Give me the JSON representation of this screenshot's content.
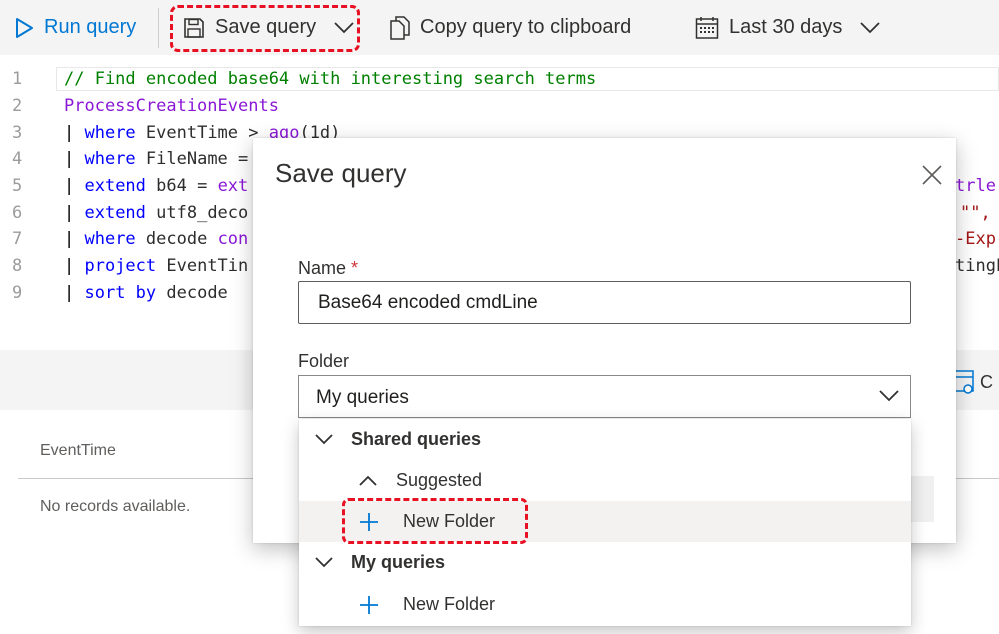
{
  "toolbar": {
    "run_label": "Run query",
    "save_label": "Save query",
    "copy_label": "Copy query to clipboard",
    "range_label": "Last 30 days"
  },
  "editor": {
    "line_numbers": [
      "1",
      "2",
      "3",
      "4",
      "5",
      "6",
      "7",
      "8",
      "9"
    ],
    "lines": [
      {
        "parts": [
          {
            "t": "// Find encoded base64 with interesting search terms",
            "c": "cmt"
          }
        ]
      },
      {
        "parts": [
          {
            "t": "ProcessCreationEvents",
            "c": "kw"
          }
        ]
      },
      {
        "parts": [
          {
            "t": "| ",
            "c": "pipe"
          },
          {
            "t": "where",
            "c": "blue"
          },
          {
            "t": " EventTime > ",
            "c": ""
          },
          {
            "t": "ago",
            "c": "kw"
          },
          {
            "t": "(1d)",
            "c": ""
          }
        ]
      },
      {
        "parts": [
          {
            "t": "| ",
            "c": "pipe"
          },
          {
            "t": "where",
            "c": "blue"
          },
          {
            "t": " FileName =",
            "c": ""
          }
        ]
      },
      {
        "parts": [
          {
            "t": "| ",
            "c": "pipe"
          },
          {
            "t": "extend",
            "c": "blue"
          },
          {
            "t": " b64 = ",
            "c": ""
          },
          {
            "t": "ext",
            "c": "kw"
          }
        ]
      },
      {
        "parts": [
          {
            "t": "| ",
            "c": "pipe"
          },
          {
            "t": "extend",
            "c": "blue"
          },
          {
            "t": " utf8_deco",
            "c": ""
          }
        ]
      },
      {
        "parts": [
          {
            "t": "| ",
            "c": "pipe"
          },
          {
            "t": "where",
            "c": "blue"
          },
          {
            "t": " decode ",
            "c": ""
          },
          {
            "t": "con",
            "c": "kw"
          }
        ]
      },
      {
        "parts": [
          {
            "t": "| ",
            "c": "pipe"
          },
          {
            "t": "project",
            "c": "blue"
          },
          {
            "t": " EventTin",
            "c": ""
          }
        ]
      },
      {
        "parts": [
          {
            "t": "| ",
            "c": "pipe"
          },
          {
            "t": "sort by",
            "c": "blue"
          },
          {
            "t": " decode",
            "c": ""
          }
        ]
      }
    ],
    "right_fragments": [
      {
        "line": 4,
        "text": "trle"
      },
      {
        "line": 5,
        "text": "\"\","
      },
      {
        "line": 6,
        "text": "-Exp"
      },
      {
        "line": 7,
        "text": "tingE"
      }
    ]
  },
  "results": {
    "column_header": "EventTime",
    "empty_text": "No records available.",
    "peek_text": "C"
  },
  "dialog": {
    "title": "Save query",
    "name_label": "Name",
    "required_mark": "*",
    "name_value": "Base64 encoded cmdLine",
    "folder_label": "Folder",
    "folder_value": "My queries"
  },
  "folder_tree": [
    {
      "label": "Shared queries",
      "icon": "chevron-down-icon",
      "bold": true
    },
    {
      "label": "Suggested",
      "icon": "chevron-up-icon",
      "bold": false
    },
    {
      "label": "New Folder",
      "icon": "plus-icon",
      "bold": false
    },
    {
      "label": "My queries",
      "icon": "chevron-down-icon",
      "bold": true
    },
    {
      "label": "New Folder",
      "icon": "plus-icon",
      "bold": false
    }
  ],
  "colors": {
    "accent": "#0078d4",
    "highlight_dash": "#e81123",
    "comment": "#008000",
    "keyword": "#8a17d6",
    "operator": "#0000ff"
  }
}
